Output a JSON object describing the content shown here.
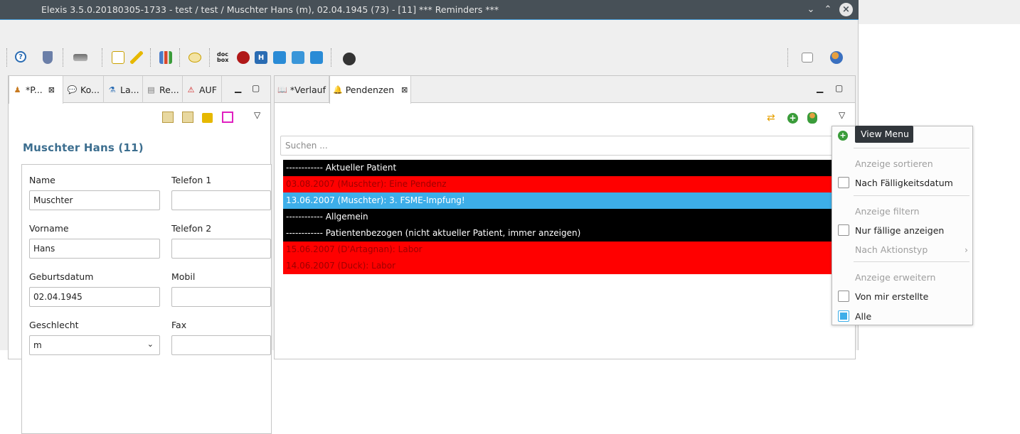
{
  "window": {
    "title": "Elexis 3.5.0.20180305-1733 - test / test / Muschter Hans (m), 02.04.1945 (73) - [11] *** Reminders ***",
    "minimize_glyph": "⌄",
    "maximize_glyph": "⌃",
    "close_glyph": "×"
  },
  "toolbar": {
    "icons": [
      "help-icon",
      "shield-icon",
      "scope-icon",
      "new-document-icon",
      "pencil-icon",
      "bar-chart-icon",
      "speech-bubble-icon",
      "docbox-icon",
      "network-icon",
      "h-icon",
      "refresh-icon",
      "calendar-icon",
      "download-icon",
      "bomb-icon",
      "perspective-icon",
      "user-switch-icon"
    ],
    "docbox_label": "doc box",
    "h_label": "H"
  },
  "left_panel": {
    "tabs": [
      {
        "label": "*P...",
        "icon": "patient-icon"
      },
      {
        "label": "Ko...",
        "icon": "chat-icon"
      },
      {
        "label": "La...",
        "icon": "flask-icon"
      },
      {
        "label": "Re...",
        "icon": "document-icon"
      },
      {
        "label": "AUF",
        "icon": "warning-icon"
      }
    ],
    "patient_title": "Muschter Hans (11)",
    "fields": {
      "name_label": "Name",
      "name_value": "Muschter",
      "telefon1_label": "Telefon 1",
      "telefon1_value": "",
      "vorname_label": "Vorname",
      "vorname_value": "Hans",
      "telefon2_label": "Telefon 2",
      "telefon2_value": "",
      "geburtsdatum_label": "Geburtsdatum",
      "geburtsdatum_value": "02.04.1945",
      "mobil_label": "Mobil",
      "mobil_value": "",
      "geschlecht_label": "Geschlecht",
      "geschlecht_value": "m",
      "fax_label": "Fax",
      "fax_value": ""
    }
  },
  "right_panel": {
    "tabs": [
      {
        "label": "*Verlauf",
        "icon": "book-icon"
      },
      {
        "label": "Pendenzen",
        "icon": "bell-icon"
      }
    ],
    "search_placeholder": "Suchen ...",
    "rows": [
      {
        "text": "------------ Aktueller Patient",
        "style": "black"
      },
      {
        "text": "03.08.2007 (Muschter): Eine Pendenz",
        "style": "red"
      },
      {
        "text": "13.06.2007 (Muschter): 3. FSME-Impfung!",
        "style": "blue"
      },
      {
        "text": "------------ Allgemein",
        "style": "black"
      },
      {
        "text": "------------ Patientenbezogen (nicht aktueller Patient, immer anzeigen)",
        "style": "black"
      },
      {
        "text": "15.06.2007 (D'Artagnan): Labor",
        "style": "red"
      },
      {
        "text": "14.06.2007 (Duck): Labor",
        "style": "red"
      }
    ]
  },
  "view_menu": {
    "tooltip": "View Menu",
    "sort_header": "Anzeige sortieren",
    "sort_due": "Nach Fälligkeitsdatum",
    "filter_header": "Anzeige filtern",
    "only_due": "Nur fällige anzeigen",
    "by_action": "Nach Aktionstyp",
    "extend_header": "Anzeige erweitern",
    "by_me": "Von mir erstellte",
    "all": "Alle",
    "checked": {
      "sort_due": false,
      "only_due": false,
      "by_me": false,
      "all": true
    }
  },
  "colors": {
    "titlebar": "#475057",
    "accent": "#3daee9",
    "row_red": "#ff0000",
    "row_black": "#000000",
    "patient_title": "#3c6e8f"
  }
}
